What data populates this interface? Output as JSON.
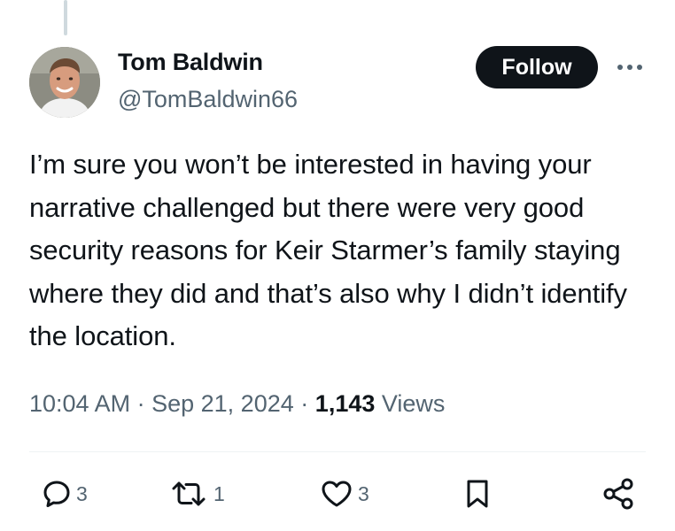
{
  "tweet": {
    "author": {
      "name": "Tom Baldwin",
      "handle": "@TomBaldwin66"
    },
    "follow_label": "Follow",
    "text": "I’m sure you won’t be interested in having your narrative challenged but there were very good security reasons for Keir Starmer’s family staying where they did and that’s also why I didn’t identify the location.",
    "time": "10:04 AM",
    "separator": "·",
    "date": "Sep 21, 2024",
    "views_count": "1,143",
    "views_label": "Views"
  },
  "actions": {
    "replies": "3",
    "reposts": "1",
    "likes": "3"
  },
  "icons": {
    "reply": "reply-icon",
    "repost": "repost-icon",
    "like": "heart-icon",
    "bookmark": "bookmark-icon",
    "share": "share-icon",
    "more": "more-icon"
  },
  "colors": {
    "text": "#0f1419",
    "secondary": "#536471",
    "follow_bg": "#0f1419",
    "follow_text": "#ffffff",
    "divider": "#eff3f4"
  }
}
